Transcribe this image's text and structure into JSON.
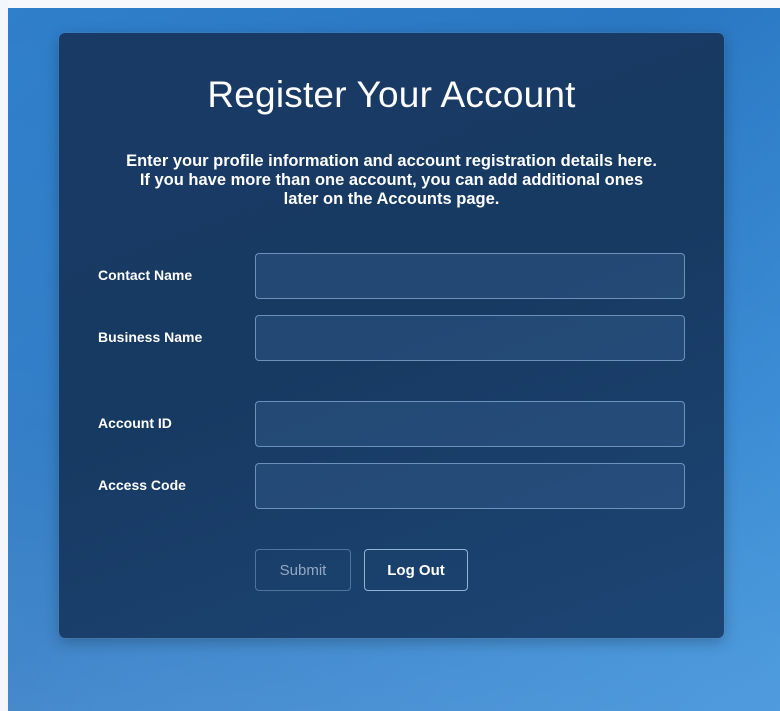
{
  "form": {
    "title": "Register Your Account",
    "intro_line1": "Enter your profile information and account registration details here.",
    "intro_line2": "If you have more than one account, you can add additional ones",
    "intro_line3": "later on the Accounts page.",
    "fields": {
      "contact_name": {
        "label": "Contact Name",
        "value": ""
      },
      "business_name": {
        "label": "Business Name",
        "value": ""
      },
      "account_id": {
        "label": "Account ID",
        "value": ""
      },
      "access_code": {
        "label": "Access Code",
        "value": ""
      }
    },
    "buttons": {
      "submit_label": "Submit",
      "logout_label": "Log Out"
    }
  },
  "colors": {
    "background": "#2f7fcb",
    "panel": "#183a64",
    "text": "#ffffff"
  }
}
